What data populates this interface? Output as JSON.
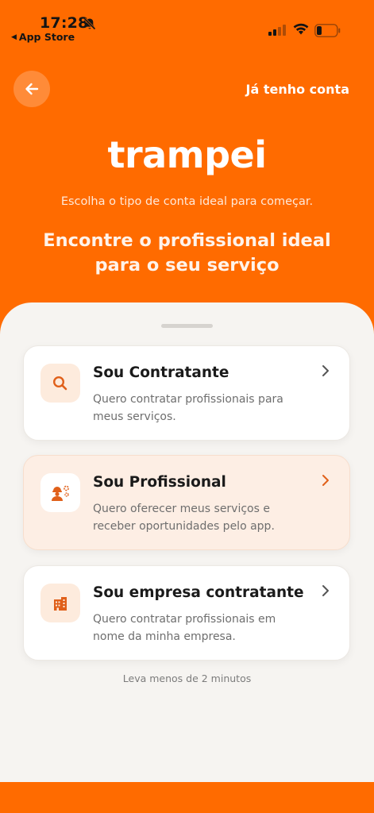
{
  "status_bar": {
    "time": "17:28",
    "back_app_label": "App Store",
    "icons": [
      "bell-off-icon",
      "signal-icon",
      "wifi-icon",
      "battery-icon"
    ]
  },
  "header": {
    "back_icon": "arrow-left-icon",
    "login_label": "Já tenho conta",
    "logo": "trampei",
    "subtitle": "Escolha o tipo de conta ideal para começar.",
    "headline_line1": "Encontre o profissional ideal",
    "headline_line2": "para o seu serviço"
  },
  "options": [
    {
      "title": "Sou Contratante",
      "description_line1": "Quero contratar profissionais para",
      "description_line2": "meus serviços.",
      "icon": "search-icon",
      "selected": false
    },
    {
      "title": "Sou Profissional",
      "description_line1": "Quero oferecer meus serviços e",
      "description_line2": "receber oportunidades pelo app.",
      "icon": "worker-icon",
      "selected": true
    },
    {
      "title": "Sou empresa contratante",
      "description_line1": "Quero contratar profissionais em",
      "description_line2": "nome da minha empresa.",
      "icon": "building-icon",
      "selected": false
    }
  ],
  "footnote": "Leva menos de 2 minutos",
  "colors": {
    "brand": "#FF6B00",
    "sheet": "#F6F4F1",
    "selected_card": "#FDEEE4",
    "icon_accent": "#E0601A"
  }
}
